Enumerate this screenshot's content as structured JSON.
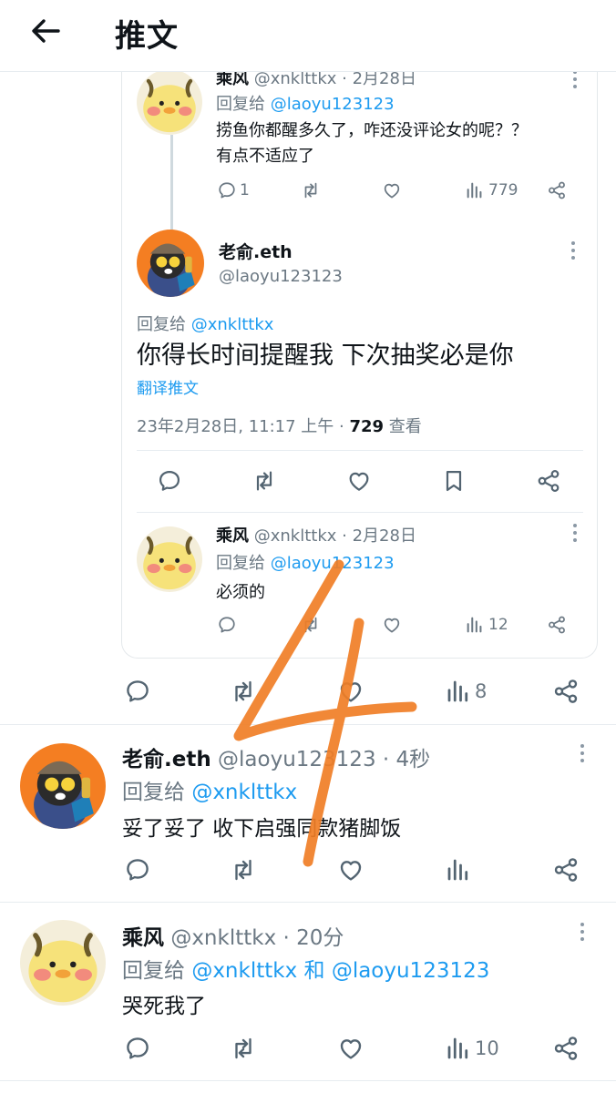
{
  "header": {
    "title": "推文",
    "back_icon": "arrow-left-icon"
  },
  "quoted_thread": {
    "reply1": {
      "name": "乘风",
      "handle": "@xnklttkx",
      "time": "· 2月28日",
      "reply_prefix": "回复给",
      "reply_to": "@laoyu123123",
      "text_line1": "捞鱼你都醒多久了，咋还没评论女的呢？？",
      "text_line2": "有点不适应了",
      "replies": "1",
      "views": "779"
    },
    "main": {
      "name": "老俞.eth",
      "handle": "@laoyu123123",
      "reply_prefix": "回复给",
      "reply_to": "@xnklttkx",
      "text": "你得长时间提醒我  下次抽奖必是你",
      "translate": "翻译推文",
      "timestamp": "23年2月28日, 11:17 上午 · ",
      "view_count": "729",
      "view_label": " 查看"
    },
    "reply2": {
      "name": "乘风",
      "handle": "@xnklttkx",
      "time": "· 2月28日",
      "reply_prefix": "回复给",
      "reply_to": "@laoyu123123",
      "text": "必须的",
      "views": "12"
    }
  },
  "outer_actions": {
    "views": "8"
  },
  "reply_a": {
    "name": "老俞.eth",
    "handle": "@laoyu123123",
    "time": "· 4秒",
    "reply_prefix": "回复给",
    "reply_to": "@xnklttkx",
    "text": "妥了妥了 收下启强同款猪脚饭"
  },
  "reply_b": {
    "name": "乘风",
    "handle": "@xnklttkx",
    "time": "· 20分",
    "reply_prefix": "回复给",
    "reply_to1": "@xnklttkx",
    "joiner": " 和 ",
    "reply_to2": "@laoyu123123",
    "text": "哭死我了",
    "views": "10"
  },
  "overlay": {
    "handwritten": "4",
    "color": "#f07e26"
  },
  "colors": {
    "link": "#1d9bf0",
    "muted": "#6b7883",
    "divider": "#e7ecf0"
  }
}
